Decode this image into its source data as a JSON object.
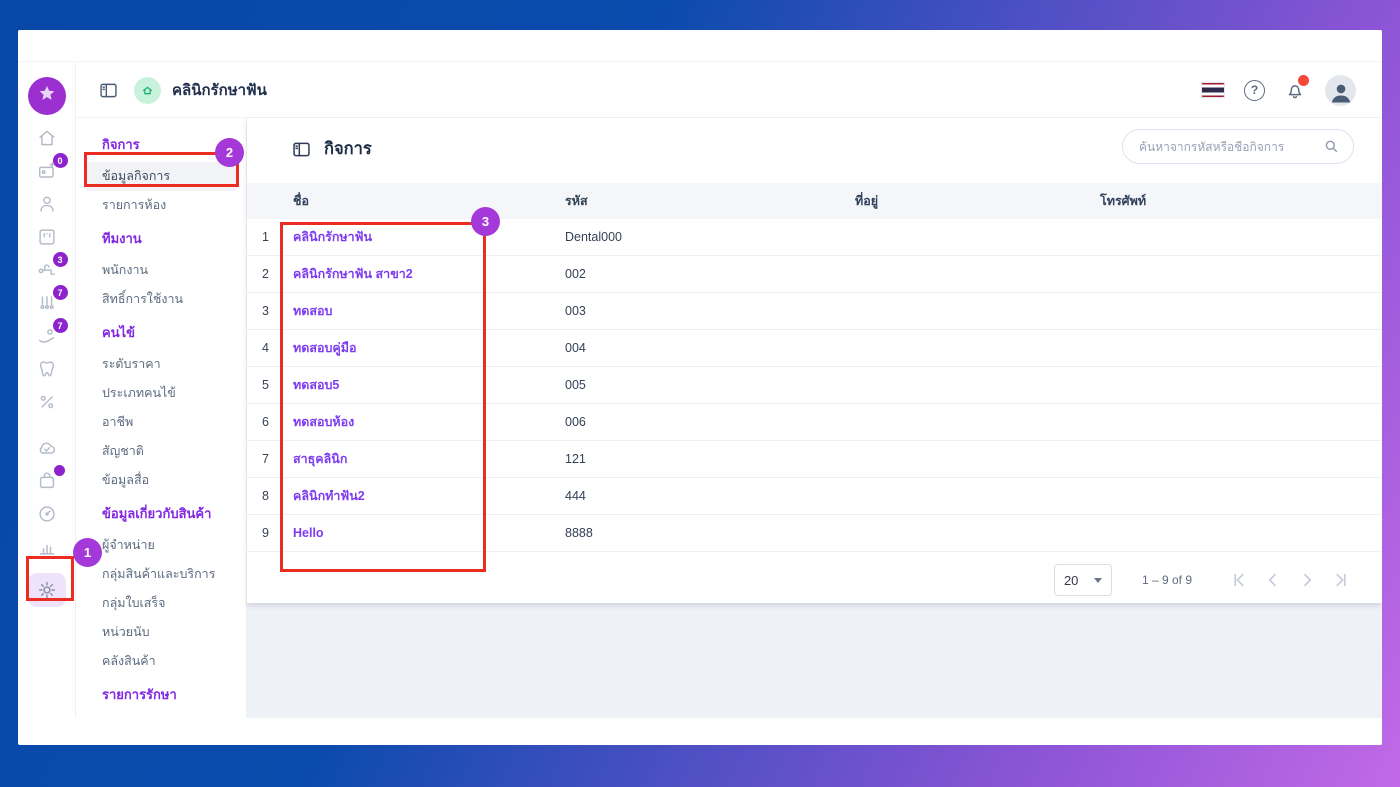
{
  "colors": {
    "accent_purple": "#7d3cf0",
    "section_header_purple": "#8227e3",
    "annotation_red": "#ea2c23",
    "annotation_circle_purple": "#a538d8",
    "badge_purple": "#8d23cc",
    "frame_blue": "#0b4bad",
    "frame_violet": "#c169e6",
    "logo_purple": "#9c2fd0",
    "home_badge_green": "#c9f2dd",
    "home_badge_teal": "#19b273",
    "notification_red": "#f4483a"
  },
  "app_header": {
    "title": "คลินิกรักษาฟัน",
    "help_symbol": "?"
  },
  "rail": {
    "items": [
      {
        "name": "home",
        "badge": ""
      },
      {
        "name": "appointments",
        "badge": "0"
      },
      {
        "name": "patients",
        "badge": ""
      },
      {
        "name": "rooms",
        "badge": ""
      },
      {
        "name": "dental-chair",
        "badge": "3"
      },
      {
        "name": "dental-tools",
        "badge": "7"
      },
      {
        "name": "services",
        "badge": "7"
      },
      {
        "name": "tooth",
        "badge": ""
      },
      {
        "name": "discounts",
        "badge": ""
      },
      {
        "name": "cloud-sync",
        "badge": ""
      },
      {
        "name": "products",
        "badge": "dot"
      },
      {
        "name": "usage-meter",
        "badge": ""
      },
      {
        "name": "reports",
        "badge": ""
      },
      {
        "name": "settings",
        "badge": "",
        "selected": true
      }
    ]
  },
  "sidebar": {
    "sections": [
      {
        "header": "กิจการ",
        "items": [
          {
            "label": "ข้อมูลกิจการ",
            "selected": true
          },
          {
            "label": "รายการห้อง",
            "selected": false
          }
        ]
      },
      {
        "header": "ทีมงาน",
        "items": [
          {
            "label": "พนักงาน",
            "selected": false
          },
          {
            "label": "สิทธิ์การใช้งาน",
            "selected": false
          }
        ]
      },
      {
        "header": "คนไข้",
        "items": [
          {
            "label": "ระดับราคา",
            "selected": false
          },
          {
            "label": "ประเภทคนไข้",
            "selected": false
          },
          {
            "label": "อาชีพ",
            "selected": false
          },
          {
            "label": "สัญชาติ",
            "selected": false
          },
          {
            "label": "ข้อมูลสื่อ",
            "selected": false
          }
        ]
      },
      {
        "header": "ข้อมูลเกี่ยวกับสินค้า",
        "items": [
          {
            "label": "ผู้จำหน่าย",
            "selected": false
          },
          {
            "label": "กลุ่มสินค้าและบริการ",
            "selected": false
          },
          {
            "label": "กลุ่มใบเสร็จ",
            "selected": false
          },
          {
            "label": "หน่วยนับ",
            "selected": false
          },
          {
            "label": "คลังสินค้า",
            "selected": false
          }
        ]
      },
      {
        "header": "รายการรักษา",
        "items": []
      }
    ]
  },
  "main": {
    "page_title": "กิจการ",
    "search": {
      "placeholder": "ค้นหาจากรหัสหรือชื่อกิจการ",
      "value": ""
    },
    "table": {
      "columns": [
        "ชื่อ",
        "รหัส",
        "ที่อยู่",
        "โทรศัพท์"
      ],
      "rows": [
        {
          "index": "1",
          "name": "คลินิกรักษาฟัน",
          "code": "Dental000",
          "address": "",
          "phone": ""
        },
        {
          "index": "2",
          "name": "คลินิกรักษาฟัน สาขา2",
          "code": "002",
          "address": "",
          "phone": ""
        },
        {
          "index": "3",
          "name": "ทดสอบ",
          "code": "003",
          "address": "",
          "phone": ""
        },
        {
          "index": "4",
          "name": "ทดสอบคู่มือ",
          "code": "004",
          "address": "",
          "phone": ""
        },
        {
          "index": "5",
          "name": "ทดสอบ5",
          "code": "005",
          "address": "",
          "phone": ""
        },
        {
          "index": "6",
          "name": "ทดสอบห้อง",
          "code": "006",
          "address": "",
          "phone": ""
        },
        {
          "index": "7",
          "name": "สาธุคลินิก",
          "code": "121",
          "address": "",
          "phone": ""
        },
        {
          "index": "8",
          "name": "คลินิกทำฟัน2",
          "code": "444",
          "address": "",
          "phone": ""
        },
        {
          "index": "9",
          "name": "Hello",
          "code": "8888",
          "address": "",
          "phone": ""
        }
      ]
    },
    "pagination": {
      "page_size": "20",
      "range_label": "1 – 9 of 9"
    }
  },
  "annotations": [
    {
      "number": "1"
    },
    {
      "number": "2"
    },
    {
      "number": "3"
    }
  ]
}
